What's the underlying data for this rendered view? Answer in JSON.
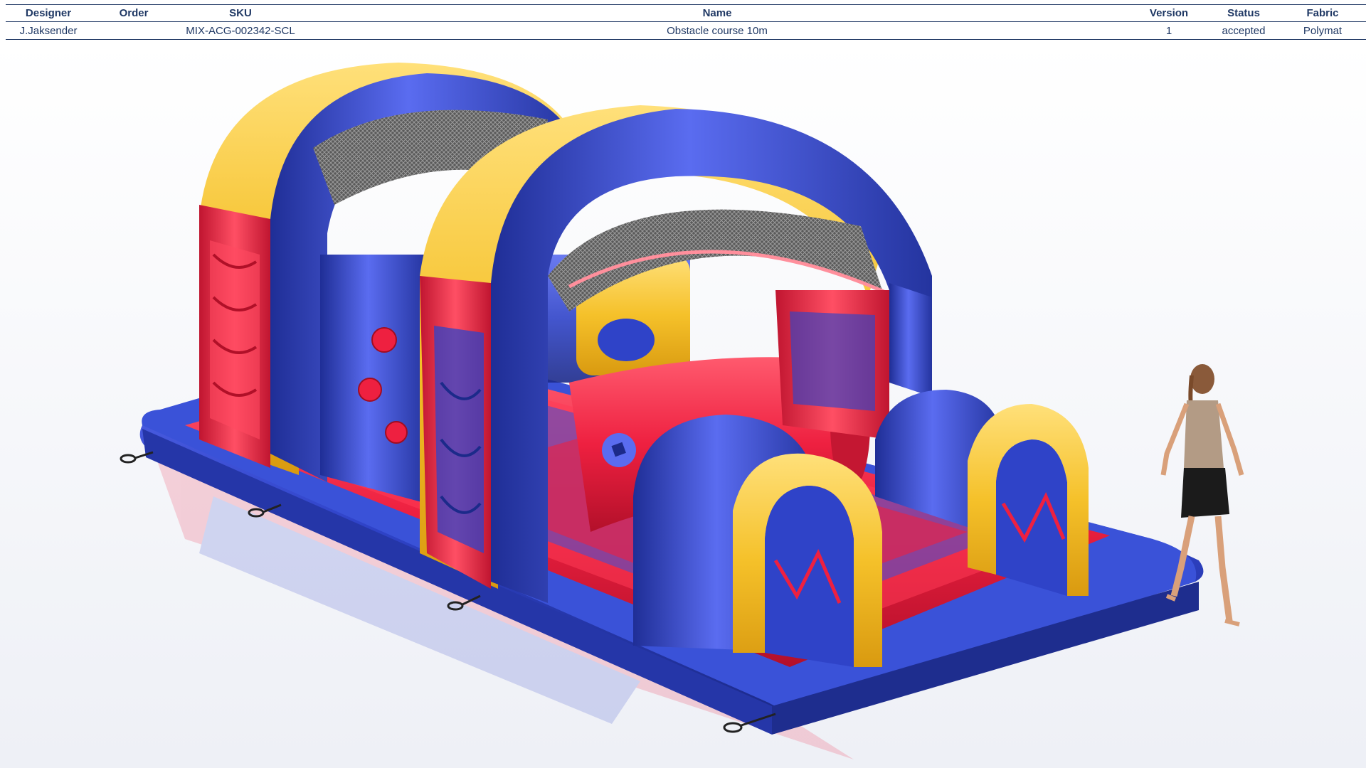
{
  "spec_table": {
    "headers": {
      "designer": "Designer",
      "order": "Order",
      "sku": "SKU",
      "name": "Name",
      "version": "Version",
      "status": "Status",
      "fabric": "Fabric"
    },
    "row": {
      "designer": "J.Jaksender",
      "order": "",
      "sku": "MIX-ACG-002342-SCL",
      "name": "Obstacle course 10m",
      "version": "1",
      "status": "accepted",
      "fabric": "Polymat"
    }
  },
  "render": {
    "subject": "inflatable-obstacle-course",
    "colors": {
      "blue": "#2f43c8",
      "red": "#ee2040",
      "yellow": "#f5c12a",
      "header_text": "#1f3864"
    }
  }
}
